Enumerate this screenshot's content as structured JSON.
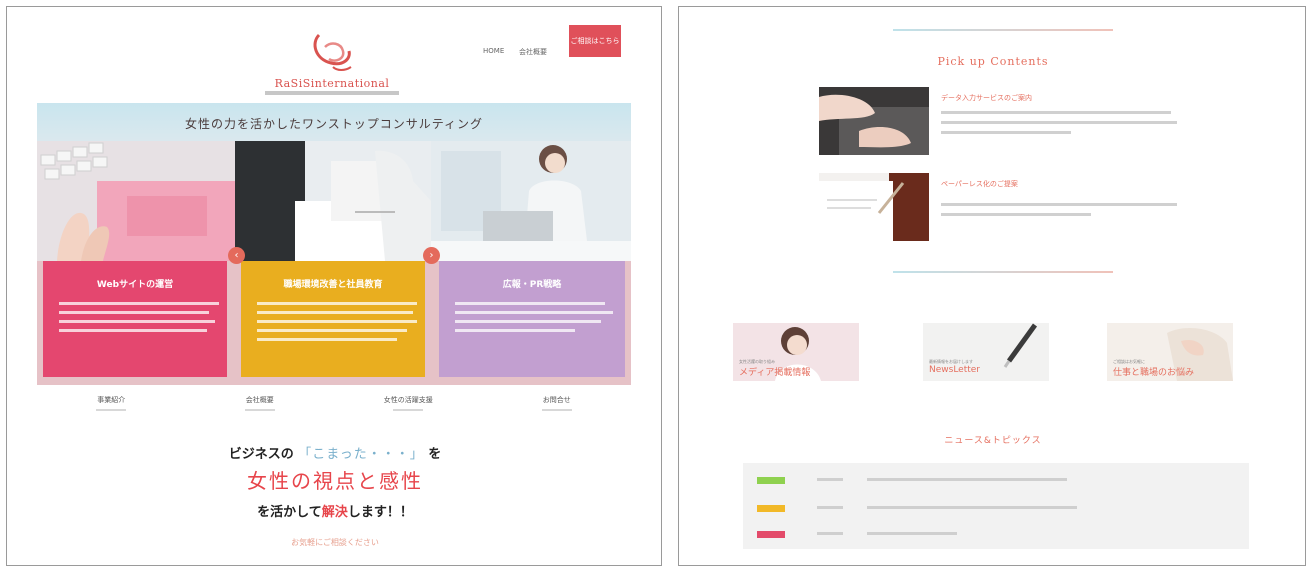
{
  "left": {
    "logo": {
      "name": "RaSiSinternational"
    },
    "nav": {
      "items": [
        "HOME",
        "会社概要"
      ],
      "recruit": "ご相談はこちら"
    },
    "hero": {
      "title": "女性の力を活かしたワンストップコンサルティング",
      "cards": [
        {
          "title": "Webサイトの運営",
          "color": "#e4476f"
        },
        {
          "title": "職場環境改善と社員教育",
          "color": "#e9ae1f"
        },
        {
          "title": "広報・PR戦略",
          "color": "#c29fd0"
        }
      ]
    },
    "tabs": [
      "事業紹介",
      "会社概要",
      "女性の活躍支援",
      "お問合せ"
    ],
    "headline": {
      "line1_prefix": "ビジネスの",
      "line1_highlight": "「こまった・・・」",
      "line1_suffix": "を",
      "line2": "女性の視点と感性",
      "line3_prefix": "を活かして",
      "line3_red": "解決",
      "line3_suffix": "します！！",
      "cta": "お気軽にご相談ください"
    }
  },
  "right": {
    "title": "Pick up Contents",
    "news": [
      {
        "heading": "データ入力サービスのご案内"
      },
      {
        "heading": "ペーパーレス化のご提案"
      }
    ],
    "banners": [
      {
        "label": "メディア掲載情報",
        "sub": "女性活躍の取り組み"
      },
      {
        "label": "NewsLetter",
        "sub": "最新情報をお届けします"
      },
      {
        "label": "仕事と職場のお悩み",
        "sub": "ご相談はお気軽に"
      }
    ],
    "topics_title": "ニュース&トピックス",
    "topics": [
      {
        "badge_color": "#8fd14f"
      },
      {
        "badge_color": "#f2b928"
      },
      {
        "badge_color": "#e34b6a"
      }
    ]
  },
  "colors": {
    "accent": "#e56f5f",
    "brand_red": "#e7454b",
    "card_pink": "#e4476f",
    "card_yellow": "#e9ae1f",
    "card_purple": "#c29fd0"
  }
}
